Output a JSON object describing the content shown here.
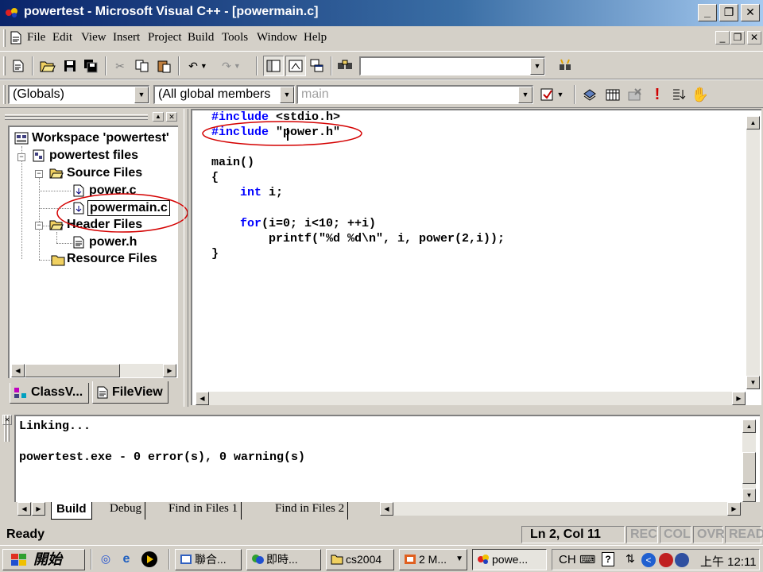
{
  "window": {
    "title": "powertest - Microsoft Visual C++ - [powermain.c]"
  },
  "menu": {
    "items": [
      "File",
      "Edit",
      "View",
      "Insert",
      "Project",
      "Build",
      "Tools",
      "Window",
      "Help"
    ]
  },
  "toolbar": {
    "find_value": "",
    "scope_combo": "(Globals)",
    "members_combo": "(All global members",
    "function_combo": "main"
  },
  "workspace": {
    "items": {
      "root": "Workspace 'powertest'",
      "project": "powertest files",
      "source_folder": "Source Files",
      "file_power_c": "power.c",
      "file_powermain_c": "powermain.c",
      "header_folder": "Header Files",
      "file_power_h": "power.h",
      "resource_folder": "Resource Files"
    },
    "tabs": {
      "classview": "ClassV...",
      "fileview": "FileView"
    }
  },
  "editor": {
    "lines": [
      {
        "kw": "#include",
        "rest": " <stdio.h>"
      },
      {
        "kw": "#include",
        "rest": " \"power.h\""
      },
      {
        "kw": "",
        "rest": ""
      },
      {
        "kw": "",
        "rest": "main()"
      },
      {
        "kw": "",
        "rest": "{"
      },
      {
        "kw": "int",
        "rest": " i;",
        "indent": "    "
      },
      {
        "kw": "",
        "rest": ""
      },
      {
        "kw": "for",
        "rest": "(i=0; i<10; ++i)",
        "indent": "    "
      },
      {
        "kw": "",
        "rest": "        printf(\"%d %d\\n\", i, power(2,i));"
      },
      {
        "kw": "",
        "rest": "}"
      }
    ]
  },
  "output": {
    "lines": [
      "Linking...",
      "",
      "powertest.exe - 0 error(s), 0 warning(s)"
    ],
    "tabs": [
      "Build",
      "Debug",
      "Find in Files 1",
      "Find in Files 2"
    ]
  },
  "status": {
    "message": "Ready",
    "position": "Ln 2, Col 11",
    "rec": "REC",
    "col": "COL",
    "ovr": "OVR",
    "read": "READ"
  },
  "taskbar": {
    "start": "開始",
    "buttons": [
      "聯合...",
      "即時...",
      "cs2004",
      "2 M...",
      "powe..."
    ],
    "lang": "CH",
    "clock": "上午 12:11"
  },
  "colors": {
    "title_start": "#0a246a",
    "title_end": "#a6caf0",
    "keyword": "#0000ff",
    "annotation": "#d40000"
  }
}
